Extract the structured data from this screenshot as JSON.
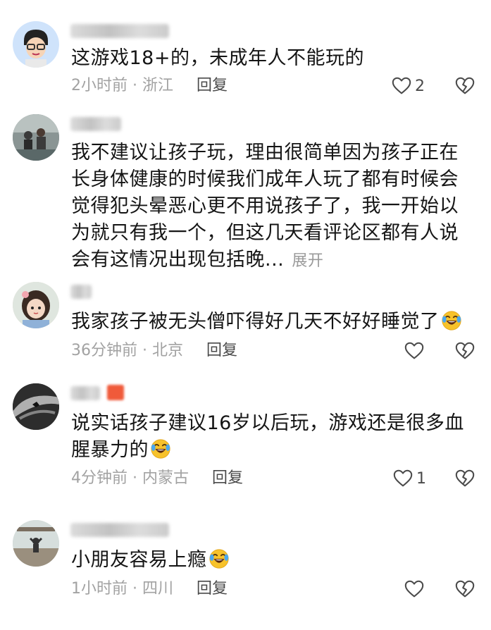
{
  "comments": [
    {
      "text": "这游戏18+的，未成年人不能玩的",
      "time": "2小时前",
      "location": "浙江",
      "reply_label": "回复",
      "likes": "2"
    },
    {
      "text": "我不建议让孩子玩，理由很简单因为孩子正在长身体健康的时候我们成年人玩了都有时候会觉得犯头晕恶心更不用说孩子了，我一开始以为就只有我一个，但这几天看评论区都有人说会有这情况出现包括晚...",
      "expand_label": "展开"
    },
    {
      "text": "我家孩子被无头僧吓得好几天不好好睡觉了",
      "emoji": "laughing-crying-emoji",
      "time": "36分钟前",
      "location": "北京",
      "reply_label": "回复",
      "likes": ""
    },
    {
      "text": "说实话孩子建议16岁以后玩，游戏还是很多血腥暴力的",
      "emoji": "laughing-crying-emoji",
      "time": "4分钟前",
      "location": "内蒙古",
      "reply_label": "回复",
      "likes": "1"
    },
    {
      "text": "小朋友容易上瘾",
      "emoji": "laughing-crying-emoji",
      "time": "1小时前",
      "location": "四川",
      "reply_label": "回复",
      "likes": ""
    }
  ],
  "separator": " · ",
  "icons": {
    "like": "heart-outline-icon",
    "dislike": "broken-heart-icon"
  }
}
